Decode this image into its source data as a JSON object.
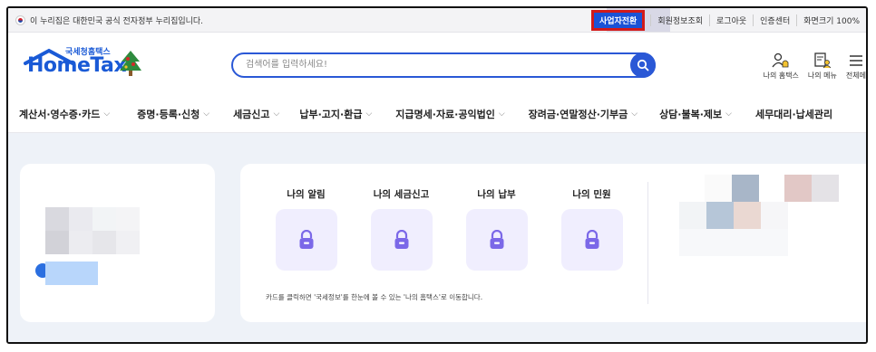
{
  "topbar": {
    "notice": "이 누리집은 대한민국 공식 전자정부 누리집입니다.",
    "business_switch": "사업자전환",
    "links": [
      "회원정보조회",
      "로그아웃",
      "인증센터",
      "화면크기 100%"
    ]
  },
  "header": {
    "logo_small": "국세청홈택스",
    "logo_big": "HomeTax",
    "search_placeholder": "검색어를 입력하세요!",
    "icons": [
      {
        "label": "나의 홈택스",
        "icon": "person-bell-icon"
      },
      {
        "label": "나의 메뉴",
        "icon": "person-doc-icon"
      },
      {
        "label": "전체메",
        "icon": "hamburger-menu-icon"
      }
    ]
  },
  "nav": {
    "items": [
      "계산서·영수증·카드",
      "증명·등록·신청",
      "세금신고",
      "납부·고지·환급",
      "지급명세·자료·공익법인",
      "장려금·연말정산·기부금",
      "상담·불복·제보",
      "세무대리·납세관리"
    ]
  },
  "my_panel": {
    "tabs": [
      "나의 알림",
      "나의 세금신고",
      "나의 납부",
      "나의 민원"
    ],
    "hint": "카드를 클릭하면 '국세정보'를 한눈에 볼 수 있는 '나의 홈택스'로 이동합니다."
  },
  "colors": {
    "brand_blue": "#1a5ad6",
    "highlight_red": "#d21a1a",
    "lock_purple": "#7b68e8",
    "content_bg": "#eef2f8"
  }
}
